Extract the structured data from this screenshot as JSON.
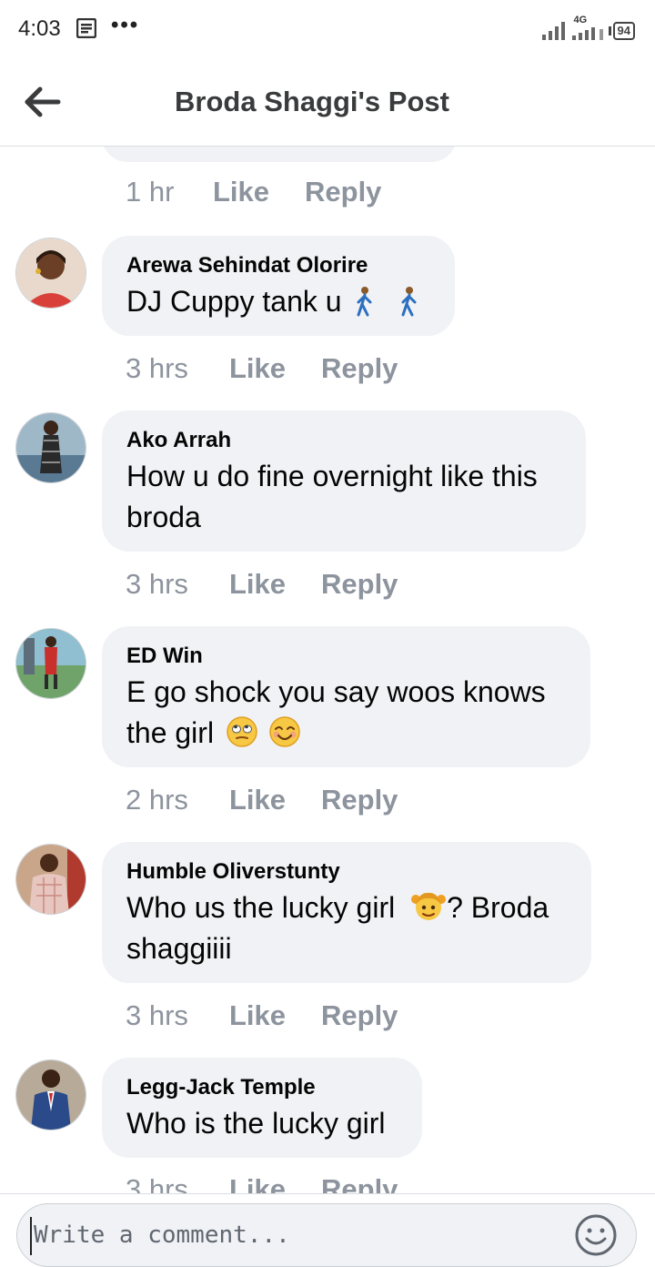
{
  "status_bar": {
    "time": "4:03",
    "network": "4G",
    "battery": "94"
  },
  "header": {
    "title": "Broda Shaggi's Post"
  },
  "actions": {
    "like": "Like",
    "reply": "Reply"
  },
  "previous_comment": {
    "time": "1 hr"
  },
  "comments": [
    {
      "author": "Arewa Sehindat Olorire",
      "text": "DJ Cuppy tank u",
      "emojis": [
        "person-walking-emoji",
        "person-walking-emoji"
      ],
      "time": "3 hrs"
    },
    {
      "author": "Ako Arrah",
      "text": "How u do fine overnight like this broda",
      "time": "3 hrs"
    },
    {
      "author": "ED Win",
      "text": "E go shock you say woos knows the girl",
      "emojis": [
        "eye-roll-emoji",
        "smiling-face-emoji"
      ],
      "time": "2 hrs"
    },
    {
      "author": "Humble Oliverstunty",
      "text_before": "Who us the lucky girl",
      "text_after": "?  Broda shaggiiii",
      "emojis": [
        "girl-emoji"
      ],
      "time": "3 hrs"
    },
    {
      "author": "Legg-Jack Temple",
      "text": "Who is the lucky girl",
      "time": "3 hrs"
    }
  ],
  "composer": {
    "placeholder": "Write a comment..."
  },
  "colors": {
    "bubble": "#f0f2f5",
    "meta_text": "#8d949e",
    "title": "#3a3b3c"
  }
}
